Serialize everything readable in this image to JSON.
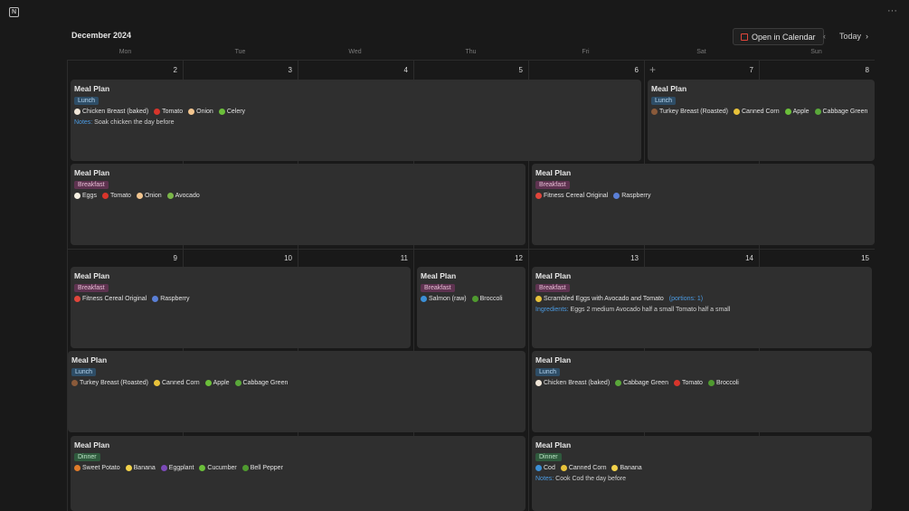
{
  "header": {
    "month": "December 2024",
    "open_calendar": "Open in Calendar",
    "today": "Today",
    "prev": "‹",
    "next": "›",
    "more": "···"
  },
  "weekdays": [
    "Mon",
    "Tue",
    "Wed",
    "Thu",
    "Fri",
    "Sat",
    "Sun"
  ],
  "week1": {
    "days": [
      "2",
      "3",
      "4",
      "5",
      "6",
      "7",
      "8"
    ],
    "add": "+"
  },
  "week2": {
    "days": [
      "9",
      "10",
      "11",
      "12",
      "13",
      "14",
      "15"
    ]
  },
  "cards": {
    "c1": {
      "title": "Meal Plan",
      "tag": "Lunch",
      "items": [
        "Chicken Breast (baked)",
        "Tomato",
        "Onion",
        "Celery"
      ],
      "note_key": "Notes:",
      "note": " Soak chicken the day before"
    },
    "c2": {
      "title": "Meal Plan",
      "tag": "Lunch",
      "items": [
        "Turkey Breast (Roasted)",
        "Canned Corn",
        "Apple",
        "Cabbage Green"
      ]
    },
    "c3": {
      "title": "Meal Plan",
      "tag": "Breakfast",
      "items": [
        "Eggs",
        "Tomato",
        "Onion",
        "Avocado"
      ]
    },
    "c4": {
      "title": "Meal Plan",
      "tag": "Breakfast",
      "items": [
        "Fitness Cereal Original",
        "Raspberry"
      ]
    },
    "c5": {
      "title": "Meal Plan",
      "tag": "Breakfast",
      "items": [
        "Fitness Cereal Original",
        "Raspberry"
      ]
    },
    "c6": {
      "title": "Meal Plan",
      "tag": "Breakfast",
      "items": [
        "Salmon (raw)",
        "Broccoli"
      ]
    },
    "c7": {
      "title": "Meal Plan",
      "tag": "Breakfast",
      "recipe": "Scrambled Eggs with Avocado and Tomato",
      "portions": "(portions: 1)",
      "note_key": "Ingredients:",
      "note": " Eggs 2 medium Avocado half a small Tomato half a small"
    },
    "c8": {
      "title": "Meal Plan",
      "tag": "Lunch",
      "items": [
        "Turkey Breast (Roasted)",
        "Canned Corn",
        "Apple",
        "Cabbage Green"
      ]
    },
    "c9": {
      "title": "Meal Plan",
      "tag": "Lunch",
      "items": [
        "Chicken Breast (baked)",
        "Cabbage Green",
        "Tomato",
        "Broccoli"
      ]
    },
    "c10": {
      "title": "Meal Plan",
      "tag": "Dinner",
      "items": [
        "Sweet Potato",
        "Banana",
        "Eggplant",
        "Cucumber",
        "Bell Pepper"
      ]
    },
    "c11": {
      "title": "Meal Plan",
      "tag": "Dinner",
      "items": [
        "Cod",
        "Canned Corn",
        "Banana"
      ],
      "note_key": "Notes:",
      "note": " Cook Cod the day before"
    }
  },
  "colors": {
    "lunch": "#2e4d66",
    "breakfast": "#5e3350",
    "dinner": "#2f5a3d",
    "link": "#4b9be3"
  }
}
